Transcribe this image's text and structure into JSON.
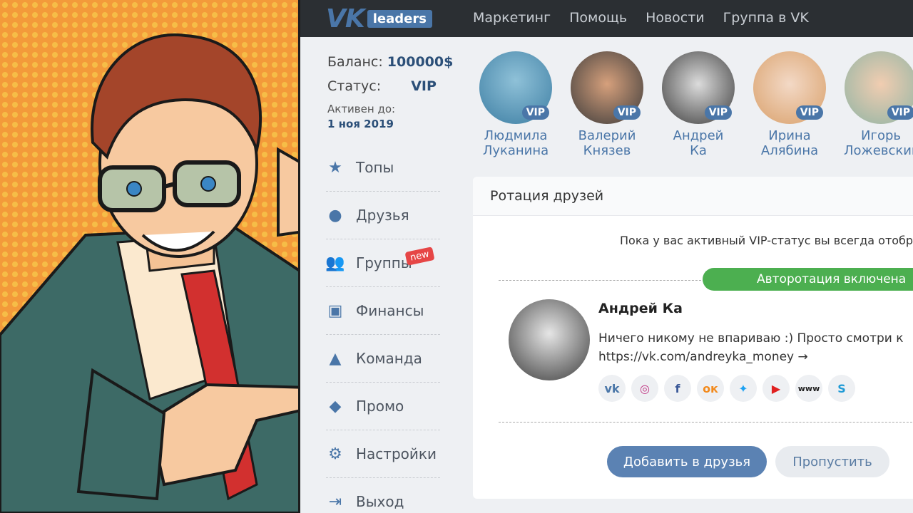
{
  "header": {
    "logo_vk": "VK",
    "logo_badge": "leaders",
    "nav": [
      "Маркетинг",
      "Помощь",
      "Новости",
      "Группа в VK"
    ]
  },
  "account": {
    "balance_label": "Баланс:",
    "balance_value": "100000$",
    "status_label": "Статус:",
    "status_value": "VIP",
    "active_label": "Активен до:",
    "active_value": "1 ноя 2019"
  },
  "menu": [
    {
      "label": "Топы",
      "icon": "star-icon"
    },
    {
      "label": "Друзья",
      "icon": "user-icon"
    },
    {
      "label": "Группы",
      "icon": "group-icon",
      "badge": "new"
    },
    {
      "label": "Финансы",
      "icon": "wallet-icon"
    },
    {
      "label": "Команда",
      "icon": "team-icon"
    },
    {
      "label": "Промо",
      "icon": "promo-icon"
    },
    {
      "label": "Настройки",
      "icon": "gear-icon"
    },
    {
      "label": "Выход",
      "icon": "exit-icon"
    }
  ],
  "vip_badge": "VIP",
  "friends": [
    {
      "first": "Людмила",
      "last": "Луканина"
    },
    {
      "first": "Валерий",
      "last": "Князев"
    },
    {
      "first": "Андрей",
      "last": "Ка"
    },
    {
      "first": "Ирина",
      "last": "Алябина"
    },
    {
      "first": "Игорь",
      "last": "Ложевский"
    }
  ],
  "card": {
    "title": "Ротация друзей",
    "notice": "Пока у вас активный VIP-статус вы всегда отобр",
    "autorotation": "Авторотация включена",
    "user_name": "Андрей Ка",
    "user_desc_line1": "Ничего никому не впариваю :) Просто смотри к",
    "user_desc_line2": "https://vk.com/andreyka_money →",
    "socials": [
      "vk-icon",
      "instagram-icon",
      "facebook-icon",
      "odnoklassniki-icon",
      "twitter-icon",
      "youtube-icon",
      "www-icon",
      "skype-icon"
    ],
    "add_button": "Добавить в друзья",
    "skip_button": "Пропустить"
  },
  "colors": {
    "accent": "#4a76a8",
    "green": "#4caf50",
    "topbar": "#2b2f33"
  }
}
